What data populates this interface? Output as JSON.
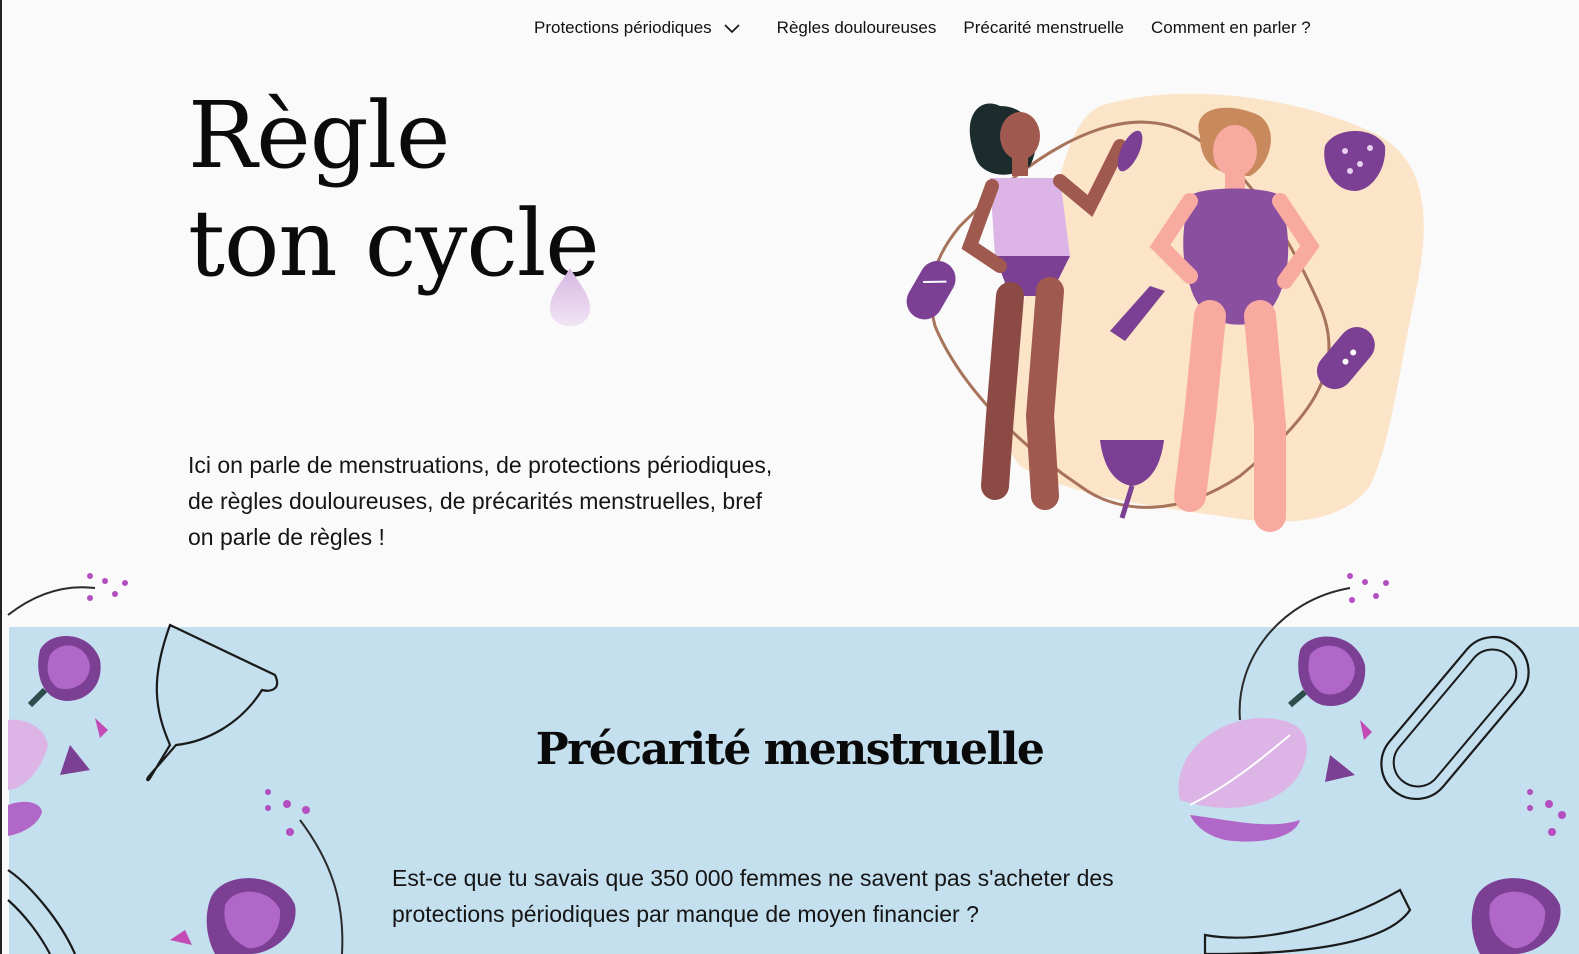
{
  "nav": {
    "items": [
      {
        "label": "Protections périodiques",
        "has_dropdown": true
      },
      {
        "label": "Règles douloureuses"
      },
      {
        "label": "Précarité menstruelle"
      },
      {
        "label": "Comment en parler ?"
      }
    ],
    "chevron_icon": "chevron-down-icon"
  },
  "hero": {
    "title_line1": "Règle",
    "title_line2": "ton cycle",
    "description": "Ici on parle de menstruations, de protections périodiques, de règles douloureuses, de précarités menstruelles, bref on parle de règles !",
    "illustration": "two-women-with-period-products-illustration"
  },
  "section": {
    "title": "Précarité menstruelle",
    "text": "Est-ce que tu savais que 350 000 femmes ne savent pas s'acheter des protections périodiques par manque de moyen financier ?",
    "background": "#c4dfee"
  },
  "colors": {
    "purple_dark": "#7b3f93",
    "purple": "#a65fc4",
    "lilac": "#dcb5e6",
    "peach": "#fbe4c8",
    "skin_dark": "#a0594f",
    "skin_light": "#f9aaa0",
    "hair_dark": "#1c2c2c",
    "hair_light": "#c88a5c"
  }
}
